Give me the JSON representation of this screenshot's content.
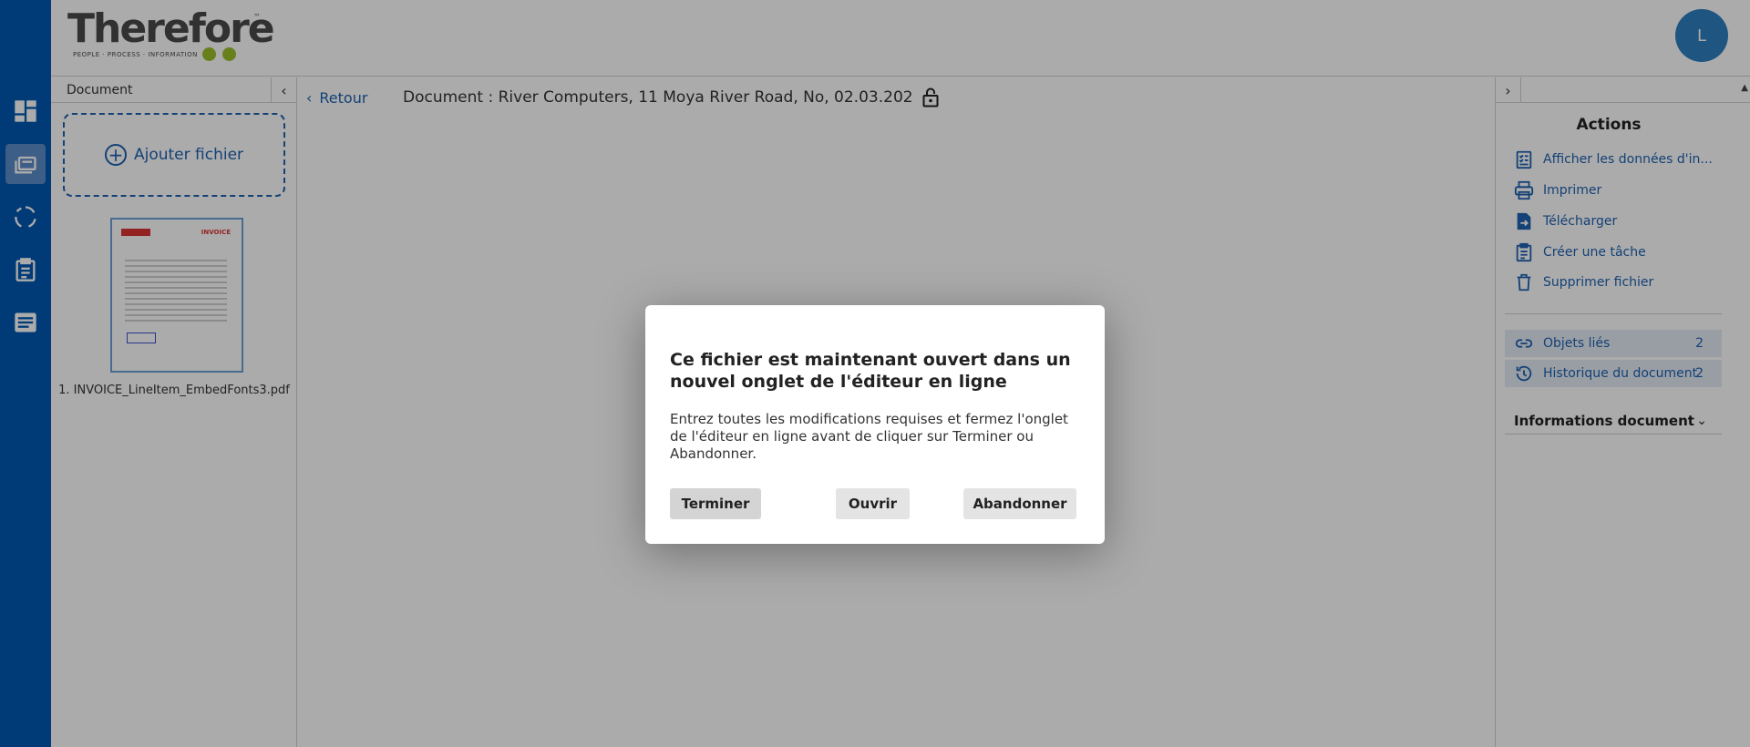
{
  "header": {
    "logo_text": "Therefore",
    "logo_tm": "™",
    "logo_tagline": "PEOPLE · PROCESS · INFORMATION",
    "avatar_letter": "L"
  },
  "nav": {
    "items": [
      "dashboard-icon",
      "folders-icon",
      "workflow-icon",
      "clipboard-icon",
      "list-icon"
    ],
    "active": "folders-icon"
  },
  "file_panel": {
    "title": "Document",
    "collapse_glyph": "‹",
    "add_file_label": "Ajouter fichier",
    "file_caption": "1. INVOICE_LineItem_EmbedFonts3.pdf",
    "thumb_invoice": "INVOICE"
  },
  "main": {
    "back_label": "Retour",
    "document_title": "Document : River Computers, 11 Moya River Road, No, 02.03.202"
  },
  "right_panel": {
    "expand_glyph": "›",
    "actions_title": "Actions",
    "actions": [
      {
        "label": "Afficher les données d'in..."
      },
      {
        "label": "Imprimer"
      },
      {
        "label": "Télécharger"
      },
      {
        "label": "Créer une tâche"
      },
      {
        "label": "Supprimer fichier"
      }
    ],
    "linked_objects": {
      "label": "Objets liés",
      "count": "2"
    },
    "history": {
      "label": "Historique du document",
      "count": "2"
    },
    "info_label": "Informations document"
  },
  "modal": {
    "title": "Ce fichier est maintenant ouvert dans un nouvel onglet de l'éditeur en ligne",
    "body": "Entrez toutes les modifications requises et fermez l'onglet de l'éditeur en ligne avant de cliquer sur Terminer ou Abandonner.",
    "buttons": {
      "finish": "Terminer",
      "open": "Ouvrir",
      "abandon": "Abandonner"
    }
  },
  "colors": {
    "nav_bg": "#0059b3",
    "accent": "#1f62b0",
    "logo_green": "#9cbf2b"
  }
}
